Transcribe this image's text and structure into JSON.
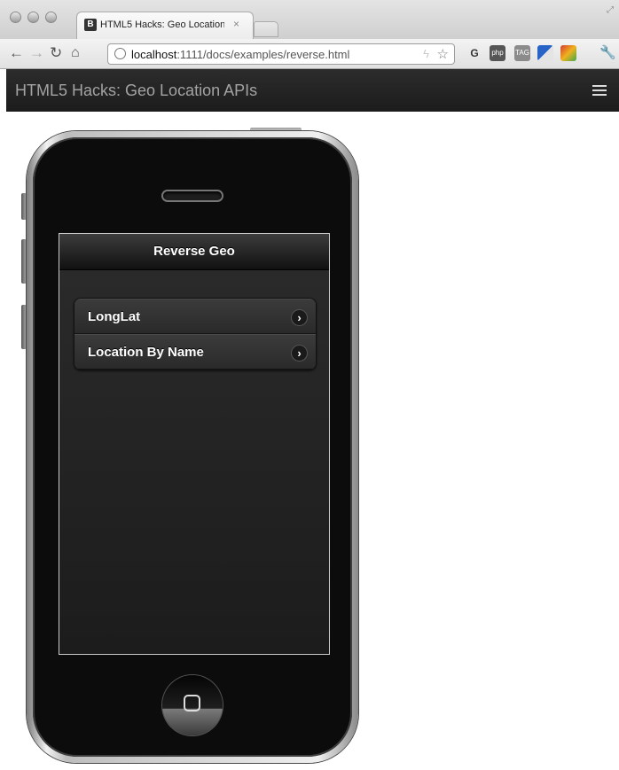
{
  "browser": {
    "tab_favicon": "B",
    "tab_title": "HTML5 Hacks: Geo Location",
    "tab_close": "×",
    "url_host": "localhost",
    "url_rest": ":1111/docs/examples/reverse.html",
    "icons": [
      "back-icon",
      "forward-icon",
      "reload-icon",
      "home-icon",
      "page-info-icon",
      "bolt-icon",
      "star-icon",
      "extension-icons",
      "wrench-icon"
    ],
    "colors": {
      "tabstrip": "#cfcfcf",
      "toolbar": "#e1e1e1"
    }
  },
  "page": {
    "title": "HTML5 Hacks: Geo Location APIs",
    "navbar_color": "#1c1c1c"
  },
  "app": {
    "header": "Reverse Geo",
    "items": [
      {
        "label": "LongLat",
        "chevron": "›"
      },
      {
        "label": "Location By Name",
        "chevron": "›"
      }
    ]
  }
}
